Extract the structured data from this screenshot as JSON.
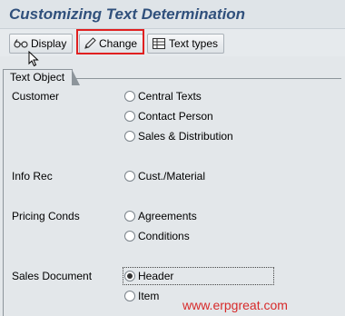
{
  "window": {
    "title": "Customizing Text Determination"
  },
  "toolbar": {
    "display_label": "Display",
    "change_label": "Change",
    "text_types_label": "Text types"
  },
  "text_object": {
    "tab_label": "Text Object",
    "groups": [
      {
        "label": "Customer",
        "options": [
          {
            "label": "Central Texts",
            "selected": false
          },
          {
            "label": "Contact Person",
            "selected": false
          },
          {
            "label": "Sales & Distribution",
            "selected": false
          }
        ]
      },
      {
        "label": "Info Rec",
        "options": [
          {
            "label": "Cust./Material",
            "selected": false
          }
        ]
      },
      {
        "label": "Pricing Conds",
        "options": [
          {
            "label": "Agreements",
            "selected": false
          },
          {
            "label": "Conditions",
            "selected": false
          }
        ]
      },
      {
        "label": "Sales Document",
        "options": [
          {
            "label": "Header",
            "selected": true
          },
          {
            "label": "Item",
            "selected": false
          }
        ]
      }
    ]
  },
  "watermark": "www.erpgreat.com",
  "colors": {
    "title": "#30507c",
    "highlight": "#e02020",
    "watermark": "#d72a2a"
  }
}
